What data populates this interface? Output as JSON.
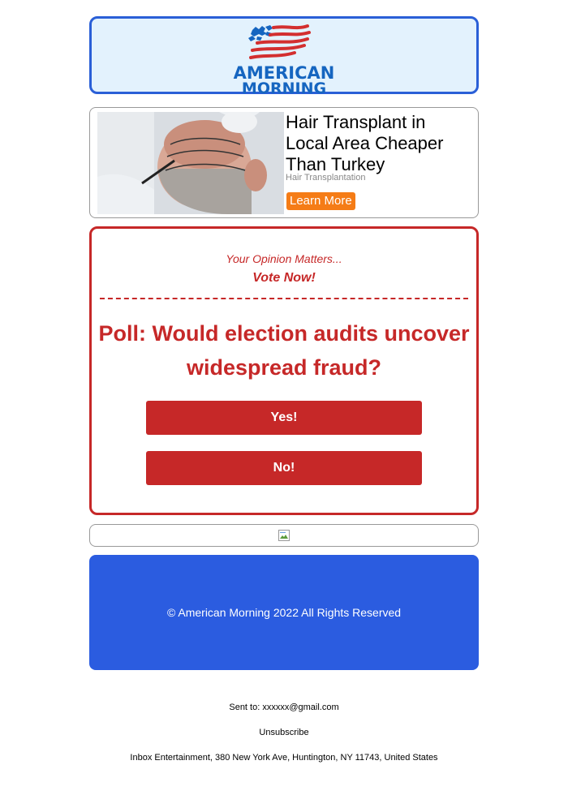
{
  "header": {
    "logo_line1": "AMERICAN",
    "logo_line2": "MORNING",
    "brand_blue": "#1565c0",
    "brand_red": "#d32f2f"
  },
  "ad": {
    "title": "Hair Transplant in Local Area Cheaper Than Turkey",
    "sponsor": "Hair Transplantation",
    "cta": "Learn More",
    "cta_color": "#f57c16"
  },
  "poll": {
    "tagline": "Your Opinion Matters...",
    "vote_now": "Vote Now!",
    "question": "Poll: Would election audits uncover widespread fraud?",
    "options": [
      "Yes!",
      "No!"
    ],
    "accent": "#c62828"
  },
  "footer": {
    "copyright": "© American Morning 2022 All Rights Reserved",
    "background": "#2b5ce0"
  },
  "meta": {
    "sent_to": "Sent to: xxxxxx@gmail.com",
    "unsubscribe": "Unsubscribe",
    "address": "Inbox Entertainment, 380 New York Ave, Huntington, NY 11743, United States"
  }
}
